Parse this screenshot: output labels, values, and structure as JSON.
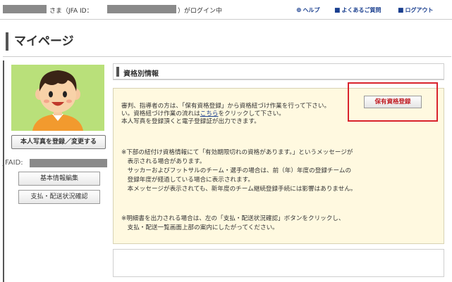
{
  "header": {
    "greeting_suffix": "さま（JFA ID：",
    "login_suffix": "）がログイン中",
    "links": [
      {
        "label": "ヘルプ",
        "icon": "help-icon"
      },
      {
        "label": "よくあるご質問",
        "icon": "faq-icon"
      },
      {
        "label": "ログアウト",
        "icon": "logout-icon"
      }
    ]
  },
  "page": {
    "title": "マイページ"
  },
  "sidebar": {
    "photo_button": "本人写真を登録／変更する",
    "jfaid_label": "JFAID:",
    "buttons": [
      "基本情報編集",
      "支払・配送状況確認"
    ]
  },
  "main": {
    "section_title": "資格別情報",
    "register_button": "保有資格登録",
    "para1": {
      "line1": "審判、指導者の方は、「保有資格登録」から資格紐づけ作業を行って下さい。",
      "line2_before": "い。資格紐づけ作業の流れは",
      "line2_link": "こちら",
      "line2_after": "をクリックして下さい。",
      "line3": "本人写真を登録頂くと電子登録証が出力できます。"
    },
    "para2": {
      "line1": "※下部の紐付け資格情報にて「有効期限切れの資格があります。」というメッセージが",
      "line2": "　表示される場合があります。",
      "line3": "　サッカーおよびフットサルのチーム・選手の場合は、前（年）年度の登録チームの",
      "line4": "　登録年度が経過している場合に表示されます。",
      "line5": "　本メッセージが表示されても、新年度のチーム継続登録手続には影響はありません。"
    },
    "para3": {
      "line1": "※明細書を出力される場合は、左の「支払・配送状況確認」ボタンをクリックし、",
      "line2": "　支払・配送一覧画面上部の案内にしたがってください。"
    }
  },
  "colors": {
    "link": "#1a3f8f",
    "panel_bg": "#fff9e0",
    "highlight": "#d9232d",
    "avatar_bg": "#b9e07a"
  }
}
